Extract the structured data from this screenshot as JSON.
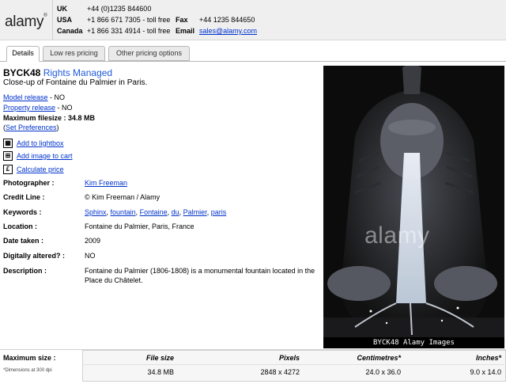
{
  "header": {
    "logo": "alamy",
    "logo_mark": "®",
    "contacts": [
      {
        "region": "UK",
        "phone": "+44 (0)1235 844600"
      },
      {
        "region": "USA",
        "phone": "+1 866 671 7305 - toll free",
        "label2": "Fax",
        "value2": "+44 1235 844650"
      },
      {
        "region": "Canada",
        "phone": "+1 866 331 4914 - toll free",
        "label2": "Email",
        "value2": "sales@alamy.com"
      }
    ]
  },
  "tabs": [
    {
      "label": "Details",
      "active": true
    },
    {
      "label": "Low res pricing",
      "active": false
    },
    {
      "label": "Other pricing options",
      "active": false
    }
  ],
  "image": {
    "id": "BYCK48",
    "license": "Rights Managed",
    "caption": "Close-up of Fontaine du Palmier in Paris.",
    "model_release_label": "Model release",
    "model_release_value": " - NO",
    "property_release_label": "Property release",
    "property_release_value": " - NO",
    "max_filesize": "Maximum filesize : 34.8 MB",
    "set_preferences": "Set Preferences",
    "watermark": "alamy",
    "photo_caption": "BYCK48  Alamy Images"
  },
  "actions": [
    {
      "icon": "lightbox-icon",
      "glyph": "▦",
      "label": "Add to lightbox"
    },
    {
      "icon": "cart-icon",
      "glyph": "⊞",
      "label": "Add image to cart"
    },
    {
      "icon": "price-icon",
      "glyph": "£",
      "label": "Calculate price"
    }
  ],
  "details": {
    "photographer_label": "Photographer :",
    "photographer": "Kim Freeman",
    "credit_label": "Credit Line :",
    "credit": "© Kim Freeman / Alamy",
    "keywords_label": "Keywords :",
    "keywords": [
      "Sphinx",
      "fountain",
      "Fontaine",
      "du",
      "Palmier",
      "paris"
    ],
    "location_label": "Location :",
    "location": "Fontaine du Palmier, Paris, France",
    "date_label": "Date taken :",
    "date": "2009",
    "altered_label": "Digitally altered? :",
    "altered": "NO",
    "description_label": "Description :",
    "description": "Fontaine du Palmier (1806-1808) is a monumental fountain located in the Place du Châtelet."
  },
  "size": {
    "title": "Maximum size :",
    "note": "*Dimensions at 300 dpi",
    "headers": [
      "File size",
      "Pixels",
      "Centimetres*",
      "Inches*"
    ],
    "values": [
      "34.8 MB",
      "2848 x 4272",
      "24.0 x 36.0",
      "9.0 x 14.0"
    ]
  }
}
